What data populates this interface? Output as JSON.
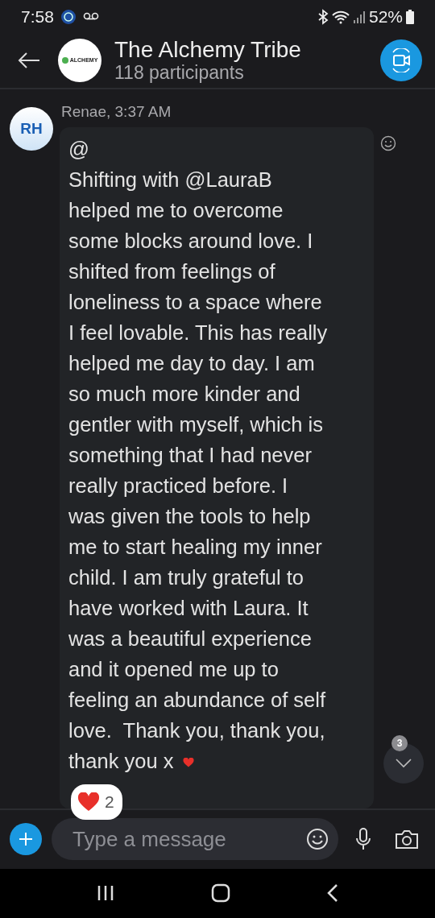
{
  "status_bar": {
    "time": "7:58",
    "battery": "52%"
  },
  "header": {
    "title": "The Alchemy Tribe",
    "subtitle": "118 participants",
    "logo_text": "ALCHEMY"
  },
  "message": {
    "avatar": "RH",
    "sender": "Renae, 3:37 AM",
    "mention": "@",
    "lines": [
      "Shifting with @LauraB",
      "helped me to overcome",
      "some blocks around love. I",
      "shifted from feelings of",
      "loneliness to a space where",
      "I feel lovable. This has really",
      "helped me day to day. I am",
      "so much more kinder and",
      "gentler with myself, which is",
      "something that I had never",
      "really practiced before. I",
      "was given the tools to help",
      "me to start healing my inner",
      "child. I am truly grateful to",
      "have worked with Laura. It",
      "was a beautiful experience",
      "and it opened me up to",
      "feeling an abundance of self",
      "love.  Thank you, thank you,",
      "thank you x"
    ],
    "reaction_count": "2"
  },
  "scroll_button": {
    "badge": "3"
  },
  "composer": {
    "placeholder": "Type a message"
  }
}
